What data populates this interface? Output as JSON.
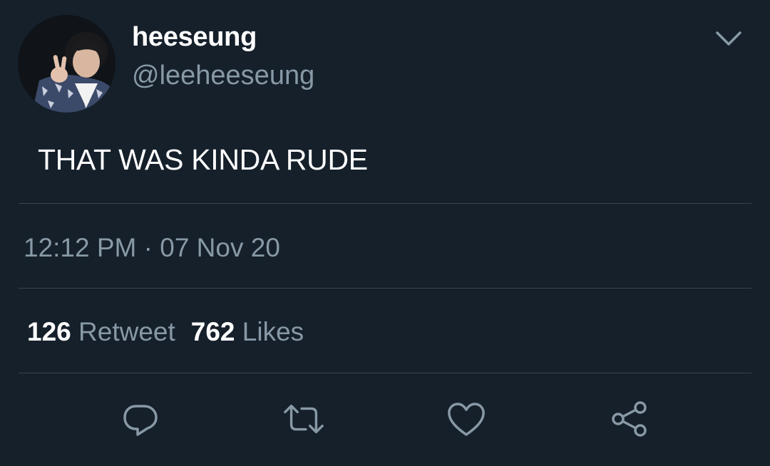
{
  "user": {
    "display_name": "heeseung",
    "handle": "@leeheeseung",
    "avatar_icon": "profile-photo"
  },
  "tweet": {
    "text": "THAT WAS KINDA RUDE",
    "timestamp": "12:12 PM · 07 Nov 20"
  },
  "stats": {
    "retweets_count": "126",
    "retweets_label": "Retweet",
    "likes_count": "762",
    "likes_label": "Likes"
  },
  "actions": [
    {
      "icon": "reply-icon"
    },
    {
      "icon": "retweet-icon"
    },
    {
      "icon": "like-icon"
    },
    {
      "icon": "share-icon"
    }
  ],
  "colors": {
    "background": "#15202b",
    "primary_text": "#ffffff",
    "secondary_text": "#8899a6",
    "divider": "#38444d"
  }
}
